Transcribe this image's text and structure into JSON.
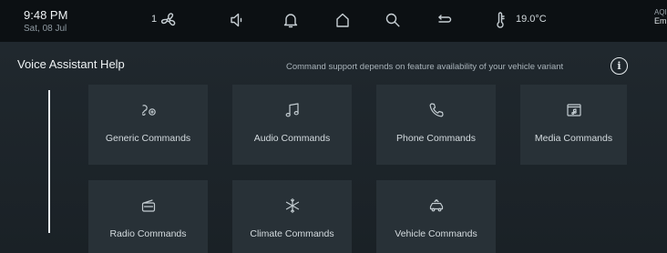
{
  "status_bar": {
    "time": "9:48 PM",
    "date": "Sat, 08 Jul",
    "fan_level": "1",
    "temperature": "19.0°C",
    "edge_label_top": "AQI",
    "edge_label_bottom": "Em",
    "icons": [
      "fan-icon",
      "volume-icon",
      "bell-icon",
      "home-icon",
      "search-icon",
      "return-icon",
      "thermometer-icon"
    ]
  },
  "header": {
    "title": "Voice Assistant Help",
    "notice": "Command support depends on feature availability of your vehicle variant",
    "info_symbol": "i"
  },
  "tiles": [
    {
      "label": "Generic Commands",
      "icon": "voice-command-icon"
    },
    {
      "label": "Audio Commands",
      "icon": "music-note-icon"
    },
    {
      "label": "Phone Commands",
      "icon": "phone-icon"
    },
    {
      "label": "Media Commands",
      "icon": "media-folder-icon"
    },
    {
      "label": "Radio Commands",
      "icon": "radio-icon"
    },
    {
      "label": "Climate Commands",
      "icon": "snowflake-icon"
    },
    {
      "label": "Vehicle Commands",
      "icon": "vehicle-icon"
    }
  ],
  "colors": {
    "background": "#1b2228",
    "status_bar": "#0c1013",
    "tile": "#283137",
    "text": "#d4dbdf"
  }
}
